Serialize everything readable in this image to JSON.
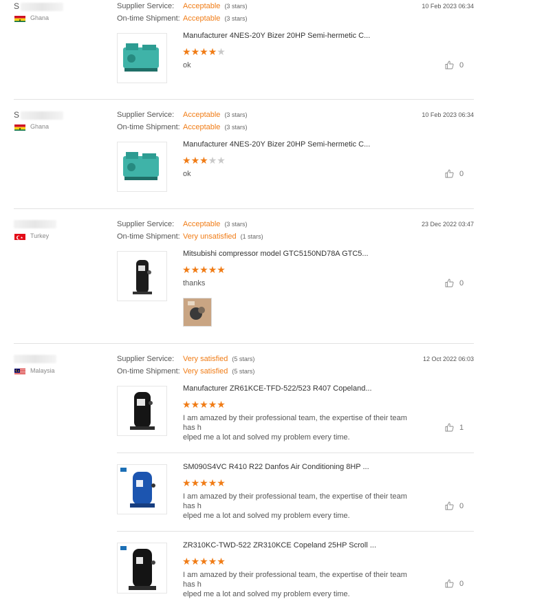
{
  "labels": {
    "supplier_service": "Supplier Service:",
    "ontime_shipment": "On-time Shipment:"
  },
  "reviews": [
    {
      "buyer_initial": "S",
      "country": "Ghana",
      "supplier_service": "Acceptable",
      "supplier_service_stars": "(3 stars)",
      "ontime_shipment": "Acceptable",
      "ontime_shipment_stars": "(3 stars)",
      "date": "10 Feb 2023 06:34",
      "items": [
        {
          "product": "Manufacturer 4NES-20Y Bizer 20HP Semi-hermetic C...",
          "rating": 4,
          "comment": "ok",
          "likes": "0"
        }
      ]
    },
    {
      "buyer_initial": "S",
      "country": "Ghana",
      "supplier_service": "Acceptable",
      "supplier_service_stars": "(3 stars)",
      "ontime_shipment": "Acceptable",
      "ontime_shipment_stars": "(3 stars)",
      "date": "10 Feb 2023 06:34",
      "items": [
        {
          "product": "Manufacturer 4NES-20Y Bizer 20HP Semi-hermetic C...",
          "rating": 3,
          "comment": "ok",
          "likes": "0"
        }
      ]
    },
    {
      "buyer_initial": "",
      "country": "Turkey",
      "supplier_service": "Acceptable",
      "supplier_service_stars": "(3 stars)",
      "ontime_shipment": "Very unsatisfied",
      "ontime_shipment_stars": "(1 stars)",
      "date": "23 Dec 2022 03:47",
      "items": [
        {
          "product": "Mitsubishi compressor model GTC5150ND78A GTC5...",
          "rating": 5,
          "comment": "thanks",
          "likes": "0"
        }
      ]
    },
    {
      "buyer_initial": "",
      "country": "Malaysia",
      "supplier_service": "Very satisfied",
      "supplier_service_stars": "(5 stars)",
      "ontime_shipment": "Very satisfied",
      "ontime_shipment_stars": "(5 stars)",
      "date": "12 Oct 2022 06:03",
      "items": [
        {
          "product": "Manufacturer ZR61KCE-TFD-522/523 R407 Copeland...",
          "rating": 5,
          "comment_line1": "I am amazed by their professional team, the expertise of their team has h",
          "comment_line2": "elped me a lot and solved my problem every time.",
          "likes": "1"
        },
        {
          "product": "SM090S4VC R410 R22 Danfos Air Conditioning 8HP ...",
          "rating": 5,
          "comment_line1": "I am amazed by their professional team, the expertise of their team has h",
          "comment_line2": "elped me a lot and solved my problem every time.",
          "likes": "0"
        },
        {
          "product": "ZR310KC-TWD-522 ZR310KCE Copeland 25HP Scroll ...",
          "rating": 5,
          "comment_line1": "I am amazed by their professional team, the expertise of their team has h",
          "comment_line2": "elped me a lot and solved my problem every time.",
          "likes": "0"
        }
      ]
    }
  ],
  "colors": {
    "accent": "#f07c16",
    "star_off": "#c9c9c9",
    "divider": "#e2e2e2"
  },
  "icons": {
    "like": "thumbs-up-icon",
    "star": "star-icon"
  }
}
